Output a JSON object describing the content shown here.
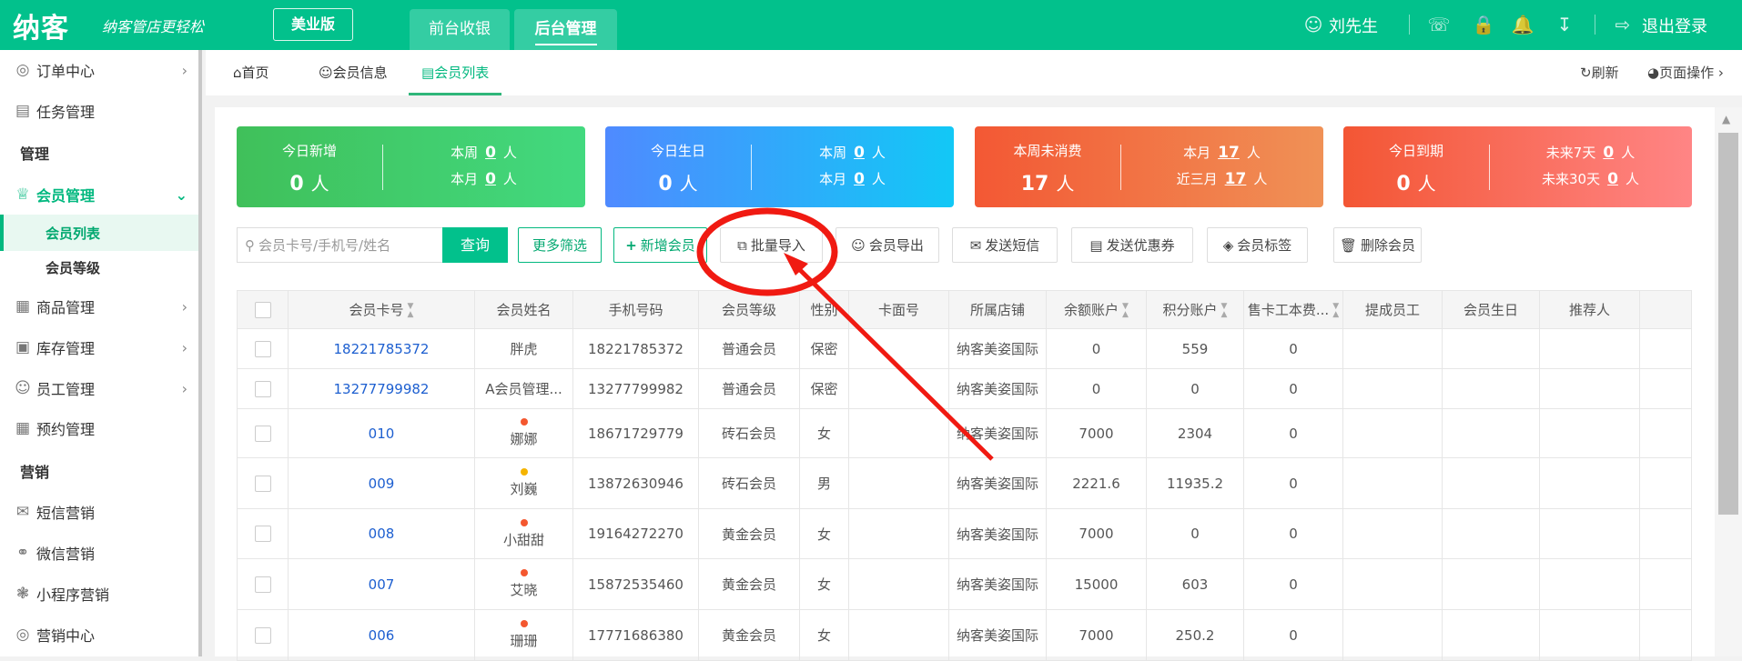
{
  "header": {
    "logo": "纳客",
    "slogan": "纳客管店更轻松",
    "edition": "美业版",
    "tabs": [
      {
        "label": "前台收银"
      },
      {
        "label": "后台管理"
      }
    ],
    "user": "刘先生",
    "logout": "退出登录"
  },
  "sidebar": {
    "items": [
      {
        "label": "订单中心",
        "icon": "globe"
      },
      {
        "label": "任务管理",
        "icon": "task"
      },
      {
        "label": "管理"
      },
      {
        "label": "会员管理",
        "icon": "crown"
      },
      {
        "label": "会员列表"
      },
      {
        "label": "会员等级"
      },
      {
        "label": "商品管理",
        "icon": "goods"
      },
      {
        "label": "库存管理",
        "icon": "stock"
      },
      {
        "label": "员工管理",
        "icon": "user"
      },
      {
        "label": "预约管理",
        "icon": "calendar"
      },
      {
        "label": "营销"
      },
      {
        "label": "短信营销",
        "icon": "mail"
      },
      {
        "label": "微信营销",
        "icon": "wechat"
      },
      {
        "label": "小程序营销",
        "icon": "miniapp"
      },
      {
        "label": "营销中心",
        "icon": "target"
      }
    ]
  },
  "page_tabs": [
    {
      "label": "首页"
    },
    {
      "label": "会员信息"
    },
    {
      "label": "会员列表"
    }
  ],
  "page_actions": {
    "refresh": "刷新",
    "page_ops": "页面操作"
  },
  "cards": [
    {
      "title": "今日新增",
      "value": "0",
      "unit": "人",
      "r1_label": "本周",
      "r1_value": "0",
      "r2_label": "本月",
      "r2_value": "0"
    },
    {
      "title": "今日生日",
      "value": "0",
      "unit": "人",
      "r1_label": "本周",
      "r1_value": "0",
      "r2_label": "本月",
      "r2_value": "0"
    },
    {
      "title": "本周未消费",
      "value": "17",
      "unit": "人",
      "r1_label": "本月",
      "r1_value": "17",
      "r2_label": "近三月",
      "r2_value": "17"
    },
    {
      "title": "今日到期",
      "value": "0",
      "unit": "人",
      "r1_label": "未来7天",
      "r1_value": "0",
      "r2_label": "未来30天",
      "r2_value": "0"
    }
  ],
  "toolbar": {
    "search_placeholder": "会员卡号/手机号/姓名",
    "query": "查询",
    "more_filter": "更多筛选",
    "add": "新增会员",
    "import": "批量导入",
    "export": "会员导出",
    "sms": "发送短信",
    "coupon": "发送优惠券",
    "tag": "会员标签",
    "delete": "删除会员"
  },
  "table": {
    "columns": [
      "会员卡号",
      "会员姓名",
      "手机号码",
      "会员等级",
      "性别",
      "卡面号",
      "所属店铺",
      "余额账户",
      "积分账户",
      "售卡工本费...",
      "提成员工",
      "会员生日",
      "推荐人"
    ],
    "rows": [
      {
        "card": "18221785372",
        "name": "胖虎",
        "phone": "18221785372",
        "level": "普通会员",
        "gender": "保密",
        "face": "",
        "shop": "纳客美姿国际",
        "balance": "0",
        "points": "559",
        "fee": "0",
        "dot": ""
      },
      {
        "card": "13277799982",
        "name": "A会员管理...",
        "phone": "13277799982",
        "level": "普通会员",
        "gender": "保密",
        "face": "",
        "shop": "纳客美姿国际",
        "balance": "0",
        "points": "0",
        "fee": "0",
        "dot": ""
      },
      {
        "card": "010",
        "name": "娜娜",
        "phone": "18671729779",
        "level": "砖石会员",
        "gender": "女",
        "face": "",
        "shop": "纳客美姿国际",
        "balance": "7000",
        "points": "2304",
        "fee": "0",
        "dot": "#f4572f"
      },
      {
        "card": "009",
        "name": "刘巍",
        "phone": "13872630946",
        "level": "砖石会员",
        "gender": "男",
        "face": "",
        "shop": "纳客美姿国际",
        "balance": "2221.6",
        "points": "11935.2",
        "fee": "0",
        "dot": "#f5b400"
      },
      {
        "card": "008",
        "name": "小甜甜",
        "phone": "19164272270",
        "level": "黄金会员",
        "gender": "女",
        "face": "",
        "shop": "纳客美姿国际",
        "balance": "7000",
        "points": "0",
        "fee": "0",
        "dot": "#f4572f"
      },
      {
        "card": "007",
        "name": "艾晓",
        "phone": "15872535460",
        "level": "黄金会员",
        "gender": "女",
        "face": "",
        "shop": "纳客美姿国际",
        "balance": "15000",
        "points": "603",
        "fee": "0",
        "dot": "#f4572f"
      },
      {
        "card": "006",
        "name": "珊珊",
        "phone": "17771686380",
        "level": "黄金会员",
        "gender": "女",
        "face": "",
        "shop": "纳客美姿国际",
        "balance": "7000",
        "points": "250.2",
        "fee": "0",
        "dot": "#f4572f"
      }
    ]
  },
  "colors": {
    "brand": "#02c18c",
    "link": "#1d5fd0",
    "annotation": "#f01a12"
  }
}
